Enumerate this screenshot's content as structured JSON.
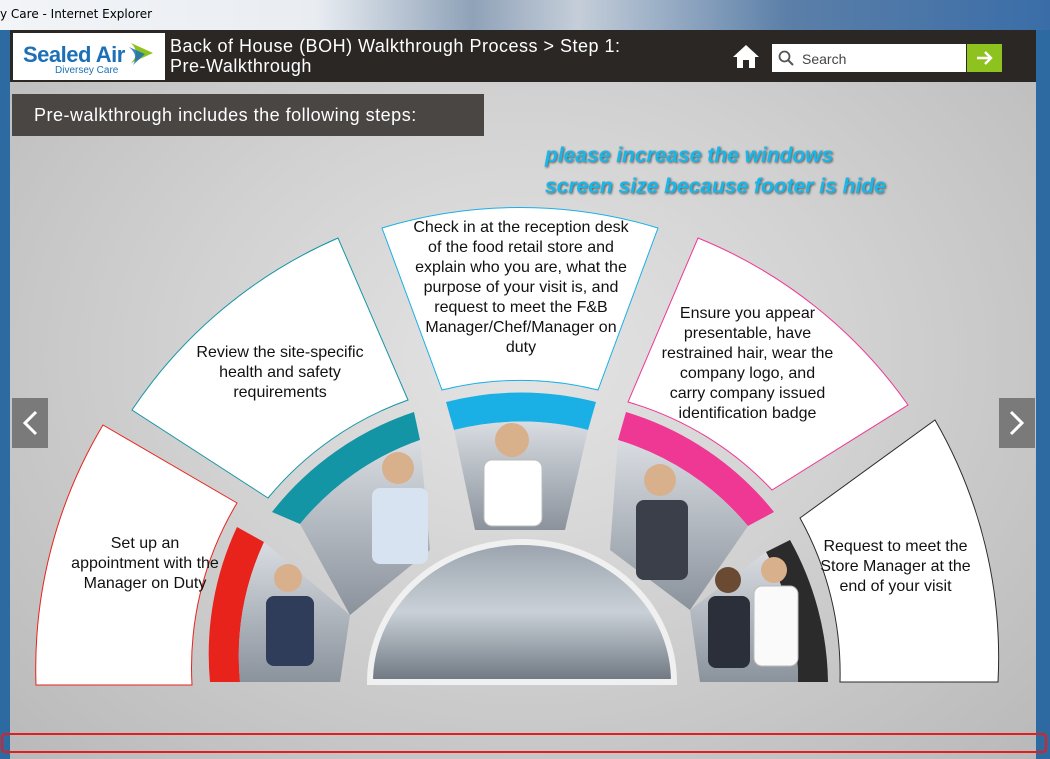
{
  "window": {
    "title": "y Care - Internet Explorer"
  },
  "header": {
    "logo_brand": "Sealed Air",
    "logo_sub": "Diversey Care",
    "title_line1": "Back of House (BOH) Walkthrough Process > Step 1:",
    "title_line2": "Pre-Walkthrough",
    "search_placeholder": "Search"
  },
  "banner": {
    "text": "Pre-walkthrough includes the following steps:"
  },
  "notice": {
    "line1": "please increase the windows",
    "line2": "screen size because footer is hide"
  },
  "steps": [
    {
      "text": "Set up an appointment with the Manager on Duty",
      "color": "#e8231c"
    },
    {
      "text": "Review the site-specific health and safety requirements",
      "color": "#1495a6"
    },
    {
      "text": "Check in at the reception desk of the food retail store and explain who you are, what the purpose of your visit is, and request to meet the F&B Manager/Chef/Manager on duty",
      "color": "#1ab0e6"
    },
    {
      "text": "Ensure you appear presentable, have restrained hair, wear the company logo, and carry company issued identification badge",
      "color": "#ef3794"
    },
    {
      "text": "Request to meet the Store Manager at the end of your visit",
      "color": "#2b2b2b"
    }
  ],
  "colors": {
    "accent_green": "#8dc21f",
    "header_bg": "#2a2725",
    "notice": "#19b6e8"
  }
}
